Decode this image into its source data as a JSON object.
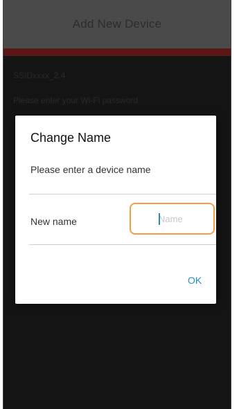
{
  "screen": {
    "title": "Add New Device",
    "ssid": "SSIDxxxx_2.4",
    "password_hint": "Please enter your Wi-Fi password"
  },
  "dialog": {
    "title": "Change Name",
    "message": "Please enter a device name",
    "field_label": "New name",
    "field_placeholder": "Name",
    "field_value": "",
    "ok_label": "OK"
  },
  "colors": {
    "header_bg": "#4a4a4a",
    "accent_bar": "#5a1515",
    "input_border": "#f0a040",
    "ok_text": "#2a8fc4"
  }
}
